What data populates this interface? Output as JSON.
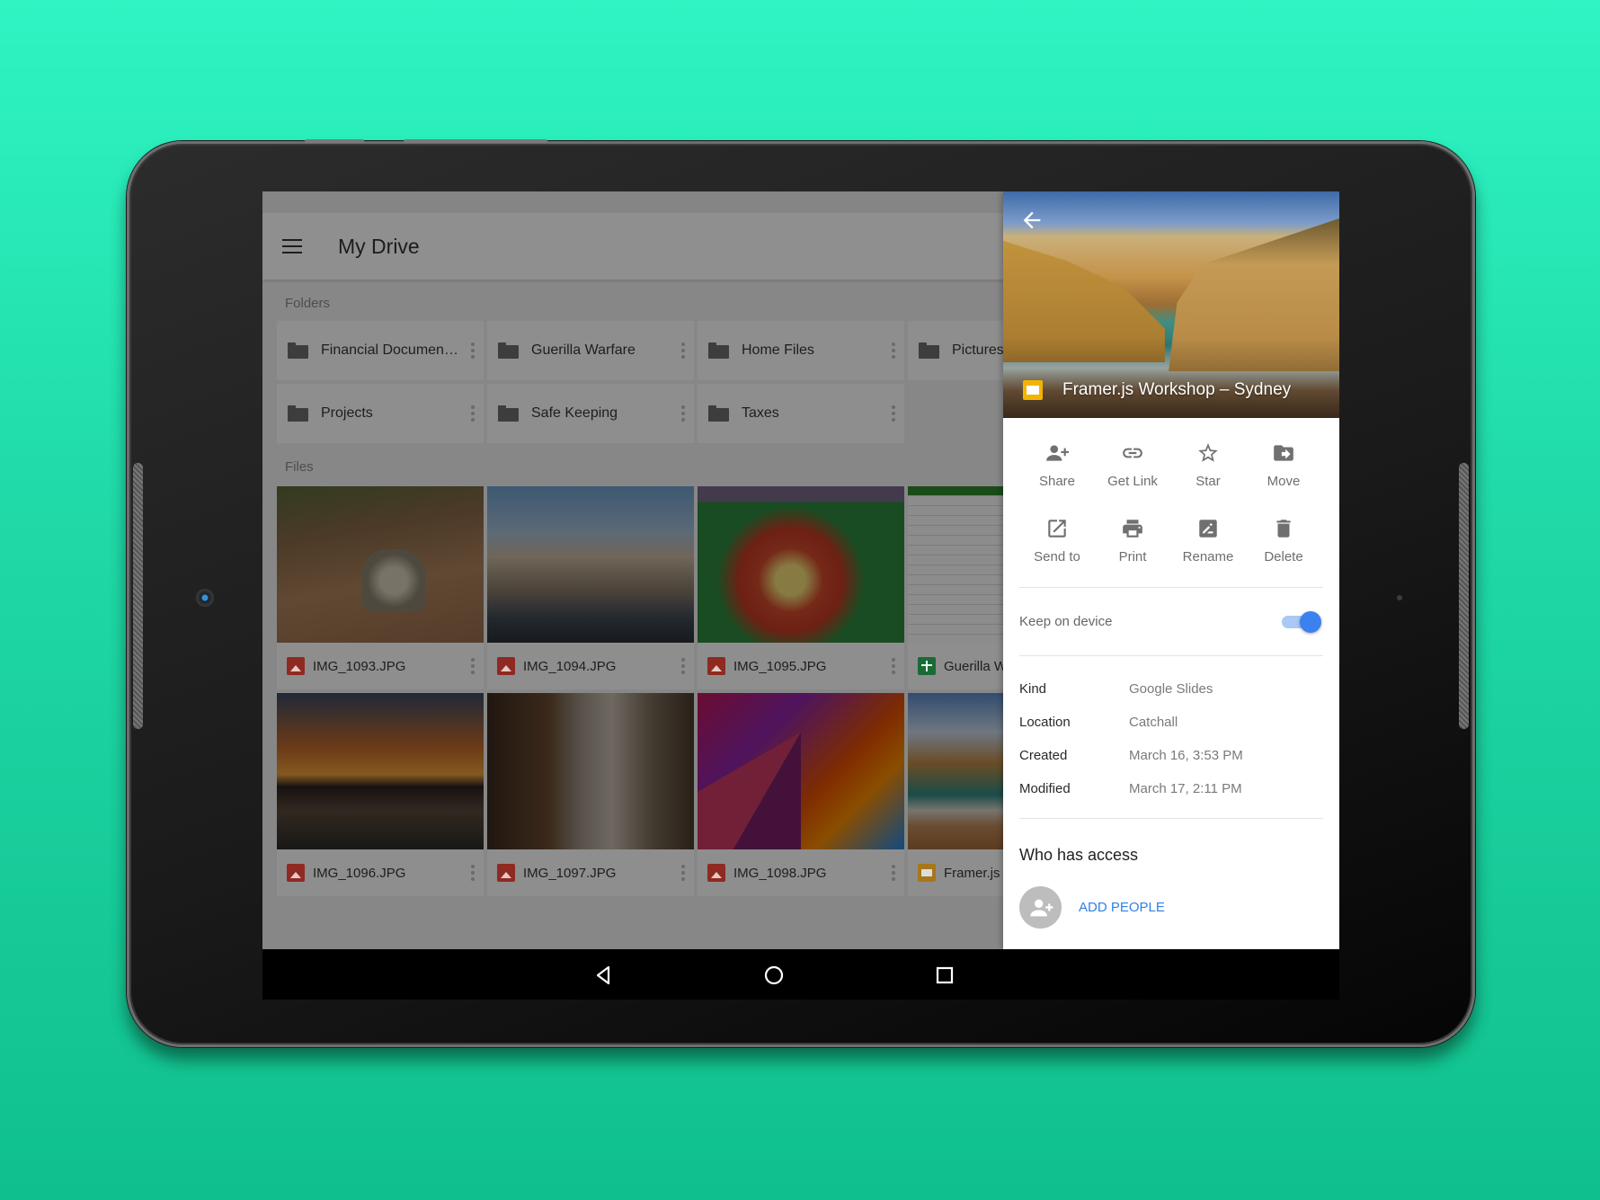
{
  "app": {
    "title": "My Drive",
    "sections": {
      "folders": "Folders",
      "files": "Files"
    }
  },
  "folders": [
    {
      "name": "Financial Documen…"
    },
    {
      "name": "Guerilla Warfare"
    },
    {
      "name": "Home Files"
    },
    {
      "name": "Pictures"
    },
    {
      "name": "Projects"
    },
    {
      "name": "Safe Keeping"
    },
    {
      "name": "Taxes"
    }
  ],
  "files": [
    {
      "name": "IMG_1093.JPG",
      "type": "image"
    },
    {
      "name": "IMG_1094.JPG",
      "type": "image"
    },
    {
      "name": "IMG_1095.JPG",
      "type": "image"
    },
    {
      "name": "Guerilla W",
      "type": "sheet"
    },
    {
      "name": "IMG_1096.JPG",
      "type": "image"
    },
    {
      "name": "IMG_1097.JPG",
      "type": "image"
    },
    {
      "name": "IMG_1098.JPG",
      "type": "image"
    },
    {
      "name": "Framer.js",
      "type": "slides"
    }
  ],
  "details": {
    "file_title": "Framer.js Workshop – Sydney",
    "actions": [
      {
        "label": "Share",
        "icon": "person-add-icon"
      },
      {
        "label": "Get Link",
        "icon": "link-icon"
      },
      {
        "label": "Star",
        "icon": "star-icon"
      },
      {
        "label": "Move",
        "icon": "move-folder-icon"
      },
      {
        "label": "Send to",
        "icon": "open-external-icon"
      },
      {
        "label": "Print",
        "icon": "print-icon"
      },
      {
        "label": "Rename",
        "icon": "rename-icon"
      },
      {
        "label": "Delete",
        "icon": "trash-icon"
      }
    ],
    "keep_on_device": {
      "label": "Keep on device",
      "enabled": true
    },
    "properties": [
      {
        "key": "Kind",
        "value": "Google Slides"
      },
      {
        "key": "Location",
        "value": "Catchall"
      },
      {
        "key": "Created",
        "value": "March 16, 3:53 PM"
      },
      {
        "key": "Modified",
        "value": "March 17, 2:11 PM"
      }
    ],
    "access_title": "Who has access",
    "add_people_label": "ADD PEOPLE"
  },
  "colors": {
    "accent_blue": "#3b82f0",
    "background_green": "#1fd8a6"
  }
}
